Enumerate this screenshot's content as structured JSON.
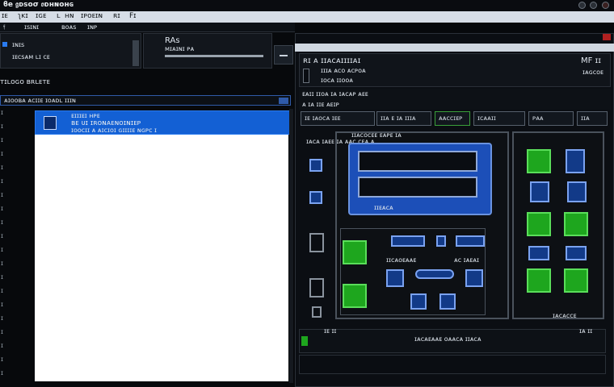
{
  "window": {
    "title": "ϐe 𝔤ᴅsoσ 𝔬ᴅʜɴᴏʜɢ",
    "top_right_icons": [
      "circle-icon",
      "circle-icon",
      "close-icon"
    ]
  },
  "menubar": {
    "items": [
      "ɪᴇ",
      "ʅᴋɪ",
      "ɪɢᴇ",
      "ʟ",
      "ʜɴ",
      "ɪᴘᴏᴇɪɴ",
      "ʀɪ",
      "Fɪ"
    ]
  },
  "tabs": [
    "𝔣",
    "ɪꜱɪɴɪ",
    "ʙᴏᴀꜱ",
    "ɪɴᴘ"
  ],
  "left": {
    "panel_a": {
      "line1": "ɪɴɪꜱ",
      "line2": "ɪᴇᴄꜱᴀᴍ ʟɪ ᴄᴇ"
    },
    "panel_b": {
      "title": "RAꜱ",
      "line": "ᴍɪᴀɪɴɪ ᴘᴀ"
    },
    "section_title": "ᴛɪʟᴏɢᴏ ʙʀʟᴇᴛᴇ",
    "breadcrumb": "ᴀɪᴏᴏʙᴀ ᴀᴄɪɪᴇ ɪᴏᴀᴅʟ ɪɪɪɴ",
    "rows": [
      "ɪ",
      "ɪ",
      "ɪ",
      "ɪ",
      "ɪ",
      "ɪ",
      "ɪ",
      "ɪ",
      "ɪ",
      "ɪ",
      "ɪ",
      "ɪ",
      "ɪ",
      "ɪ",
      "ɪ",
      "ɪ",
      "ɪ",
      "ɪ",
      "ɪ",
      "ɪ"
    ],
    "card": {
      "line1": "ᴇɪɪɪᴇɪ ʜᴘᴇ",
      "line2": "ʙᴇ ᴜɪ ɪʀᴏɴᴀᴇɴᴏɪɴɪᴇᴘ",
      "line3": "ɪᴏᴏᴄɪɪ ᴀ ᴀɪᴄɪᴏɪ ɢɪɪɪɪᴇ ɴɢᴘᴄ ɪ"
    }
  },
  "right": {
    "header": {
      "title": "ʀɪ ᴀ ɪɪᴀᴄᴀɪɪɪɪᴀɪ",
      "line2": "ɪɪɪᴀ ᴀᴄᴏ ᴀᴄᴘᴏᴀ",
      "line3": "ɪᴏᴄᴀ ɪɪᴏᴏᴀ",
      "corner": "MF ɪɪ",
      "corner2": "ɪᴀɢᴄᴏᴇ"
    },
    "toolbar": {
      "line1": "ᴇᴀɪɪ ɪɪᴏᴀ ɪᴀ ɪᴀᴄᴀᴘ ᴀᴇᴇ",
      "line2": "ᴀ ɪᴀ ɪɪᴇ ᴀᴇɪᴘ"
    },
    "buttons": [
      "ɪᴇ ɪᴀᴏᴄᴀ ɪᴇᴇ",
      "ɪɪᴀ ᴇ ɪᴀ ɪɪɪᴀ",
      "ᴀᴀᴄᴄɪᴇᴘ",
      "ɪᴄᴀᴀɪɪ",
      "ᴘᴀᴀ",
      "ɪɪᴀ"
    ],
    "diagram_title": "ɪɪᴀᴄᴏᴄᴇᴇ ᴇᴀᴘᴇ ɪᴀ",
    "diagram_sub": "ɪᴀᴄᴀ ɪᴀᴇᴇ ɪᴀ ᴀᴀᴄ ᴄᴇᴀ ᴀ",
    "device_label": "ɪɪᴇᴀᴄᴀ",
    "mid_label": "ɪɪᴄᴀᴏᴇᴀᴀᴇ",
    "mid_label2": "ᴀᴄ ɪᴀᴇᴀɪ",
    "side_label": "ɪᴀᴄᴀᴄᴄᴇ",
    "footer_label": "ɪᴇ ɪɪ",
    "footer_text": "ɪᴀᴄᴀᴇᴀᴀᴇ ᴏᴀᴀᴄᴀ ɪɪᴀᴄᴀ",
    "footer_right": "ɪᴀ ɪɪ"
  },
  "colors": {
    "accent": "#1360d4",
    "success": "#1ea61e",
    "panel": "#0b0e13"
  }
}
